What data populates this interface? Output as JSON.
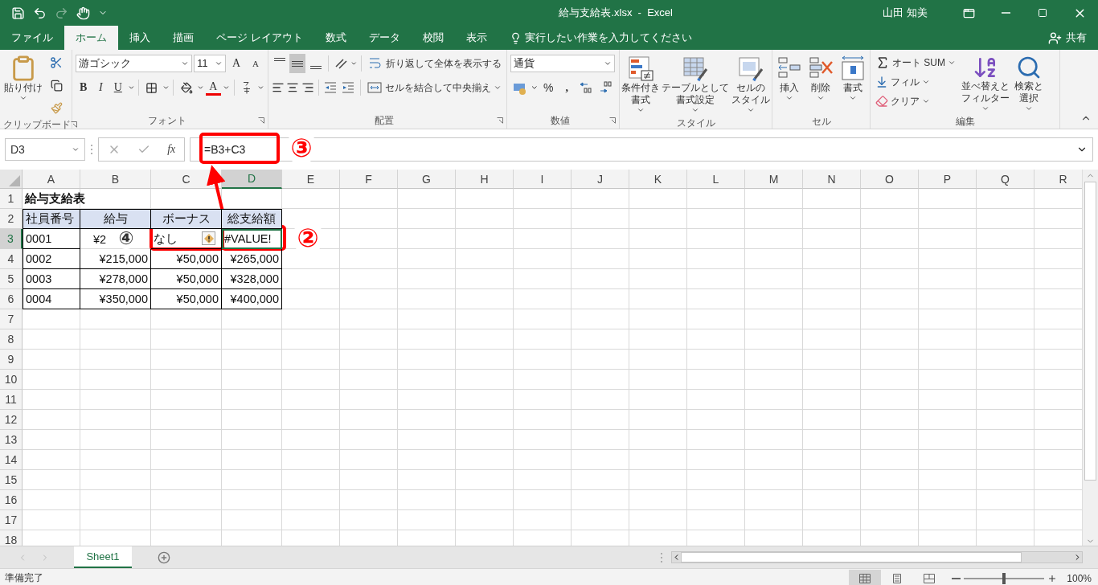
{
  "title_bar": {
    "title": "給与支給表.xlsx  -  Excel",
    "user": "山田 知美"
  },
  "ribbon_tabs": [
    {
      "label": "ファイル",
      "selected": false
    },
    {
      "label": "ホーム",
      "selected": true
    },
    {
      "label": "挿入",
      "selected": false
    },
    {
      "label": "描画",
      "selected": false
    },
    {
      "label": "ページ レイアウト",
      "selected": false
    },
    {
      "label": "数式",
      "selected": false
    },
    {
      "label": "データ",
      "selected": false
    },
    {
      "label": "校閲",
      "selected": false
    },
    {
      "label": "表示",
      "selected": false
    }
  ],
  "tell_me": "実行したい作業を入力してください",
  "share": "共有",
  "clipboard": {
    "paste": "貼り付け",
    "label": "クリップボード"
  },
  "font": {
    "name": "游ゴシック",
    "size": "11",
    "grow": "A",
    "shrink": "A",
    "bold": "B",
    "italic": "I",
    "underline": "U",
    "color_letter": "A",
    "label": "フォント"
  },
  "alignment": {
    "vertical": [
      {
        "kind": "top",
        "selected": false
      },
      {
        "kind": "middle",
        "selected": true
      },
      {
        "kind": "bottom",
        "selected": false
      }
    ],
    "wrap": "折り返して全体を表示する",
    "merge": "セルを結合して中央揃え",
    "label": "配置"
  },
  "number": {
    "format": "通貨",
    "percent": "%",
    "comma": ",",
    "label": "数値"
  },
  "styles": {
    "label": "スタイル",
    "buttons": [
      {
        "kind": "conditional",
        "lines": [
          "条件付き",
          "書式"
        ]
      },
      {
        "kind": "table",
        "lines": [
          "テーブルとして",
          "書式設定"
        ]
      },
      {
        "kind": "cell_styles",
        "lines": [
          "セルの",
          "スタイル"
        ]
      }
    ]
  },
  "cells_group": {
    "label": "セル",
    "buttons": [
      {
        "kind": "insert",
        "lines": [
          "挿入"
        ]
      },
      {
        "kind": "delete",
        "lines": [
          "削除"
        ]
      },
      {
        "kind": "format",
        "lines": [
          "書式"
        ]
      }
    ]
  },
  "editing": {
    "label": "編集",
    "small": [
      {
        "kind": "autosum",
        "text": "オート SUM"
      },
      {
        "kind": "fill",
        "text": "フィル"
      },
      {
        "kind": "clear",
        "text": "クリア"
      }
    ],
    "buttons": [
      {
        "kind": "sort",
        "lines": [
          "並べ替えと",
          "フィルター"
        ]
      },
      {
        "kind": "find",
        "lines": [
          "検索と",
          "選択"
        ]
      }
    ]
  },
  "formula_bar": {
    "name_box": "D3",
    "fx": "fx",
    "formula": "=B3+C3"
  },
  "sheet": {
    "columns": [
      {
        "label": "A",
        "selected": false
      },
      {
        "label": "B",
        "selected": false
      },
      {
        "label": "C",
        "selected": false
      },
      {
        "label": "D",
        "selected": true
      },
      {
        "label": "E",
        "selected": false
      },
      {
        "label": "F",
        "selected": false
      },
      {
        "label": "G",
        "selected": false
      },
      {
        "label": "H",
        "selected": false
      },
      {
        "label": "I",
        "selected": false
      },
      {
        "label": "J",
        "selected": false
      },
      {
        "label": "K",
        "selected": false
      },
      {
        "label": "L",
        "selected": false
      },
      {
        "label": "M",
        "selected": false
      },
      {
        "label": "N",
        "selected": false
      },
      {
        "label": "O",
        "selected": false
      },
      {
        "label": "P",
        "selected": false
      },
      {
        "label": "Q",
        "selected": false
      },
      {
        "label": "R",
        "selected": false
      }
    ],
    "rows": [
      {
        "label": "1",
        "selected": false
      },
      {
        "label": "2",
        "selected": false
      },
      {
        "label": "3",
        "selected": true
      },
      {
        "label": "4",
        "selected": false
      },
      {
        "label": "5",
        "selected": false
      },
      {
        "label": "6",
        "selected": false
      },
      {
        "label": "7",
        "selected": false
      },
      {
        "label": "8",
        "selected": false
      },
      {
        "label": "9",
        "selected": false
      },
      {
        "label": "10",
        "selected": false
      },
      {
        "label": "11",
        "selected": false
      },
      {
        "label": "12",
        "selected": false
      },
      {
        "label": "13",
        "selected": false
      },
      {
        "label": "14",
        "selected": false
      },
      {
        "label": "15",
        "selected": false
      },
      {
        "label": "16",
        "selected": false
      },
      {
        "label": "17",
        "selected": false
      },
      {
        "label": "18",
        "selected": false
      }
    ],
    "data": [
      {
        "cells": [
          {
            "text": "給与支給表",
            "kind": "title",
            "selected": false,
            "error_flag": false
          }
        ]
      },
      {
        "cells": [
          {
            "text": "社員番号",
            "kind": "header_left",
            "selected": false,
            "error_flag": false
          },
          {
            "text": "給与",
            "kind": "header",
            "selected": false,
            "error_flag": false
          },
          {
            "text": "ボーナス",
            "kind": "header",
            "selected": false,
            "error_flag": false
          },
          {
            "text": "総支給額",
            "kind": "header",
            "selected": false,
            "error_flag": false
          }
        ]
      },
      {
        "cells": [
          {
            "text": "0001",
            "kind": "text",
            "selected": false,
            "error_flag": false
          },
          {
            "text": "¥2",
            "kind": "partial",
            "selected": false,
            "error_flag": false
          },
          {
            "text": "なし",
            "kind": "text",
            "selected": false,
            "error_flag": true
          },
          {
            "text": "#VALUE!",
            "kind": "text",
            "selected": true,
            "error_flag": false
          }
        ]
      },
      {
        "cells": [
          {
            "text": "0002",
            "kind": "text",
            "selected": false,
            "error_flag": false
          },
          {
            "text": "¥215,000",
            "kind": "number",
            "selected": false,
            "error_flag": false
          },
          {
            "text": "¥50,000",
            "kind": "number",
            "selected": false,
            "error_flag": false
          },
          {
            "text": "¥265,000",
            "kind": "number",
            "selected": false,
            "error_flag": false
          }
        ]
      },
      {
        "cells": [
          {
            "text": "0003",
            "kind": "text",
            "selected": false,
            "error_flag": false
          },
          {
            "text": "¥278,000",
            "kind": "number",
            "selected": false,
            "error_flag": false
          },
          {
            "text": "¥50,000",
            "kind": "number",
            "selected": false,
            "error_flag": false
          },
          {
            "text": "¥328,000",
            "kind": "number",
            "selected": false,
            "error_flag": false
          }
        ]
      },
      {
        "cells": [
          {
            "text": "0004",
            "kind": "text",
            "selected": false,
            "error_flag": false
          },
          {
            "text": "¥350,000",
            "kind": "number",
            "selected": false,
            "error_flag": false
          },
          {
            "text": "¥50,000",
            "kind": "number",
            "selected": false,
            "error_flag": false
          },
          {
            "text": "¥400,000",
            "kind": "number",
            "selected": false,
            "error_flag": false
          }
        ]
      }
    ]
  },
  "annotations": [
    {
      "label": "③",
      "color": "#ff0000"
    },
    {
      "label": "②",
      "color": "#ff0000"
    },
    {
      "label": "④",
      "color": "#333333"
    }
  ],
  "sheet_tabs": [
    {
      "label": "Sheet1",
      "selected": true
    }
  ],
  "status": {
    "text": "準備完了",
    "views": [
      {
        "kind": "normal",
        "selected": true
      },
      {
        "kind": "page_layout",
        "selected": false
      },
      {
        "kind": "page_break",
        "selected": false
      }
    ],
    "zoom": {
      "level": 0.5,
      "label": "100%"
    }
  }
}
